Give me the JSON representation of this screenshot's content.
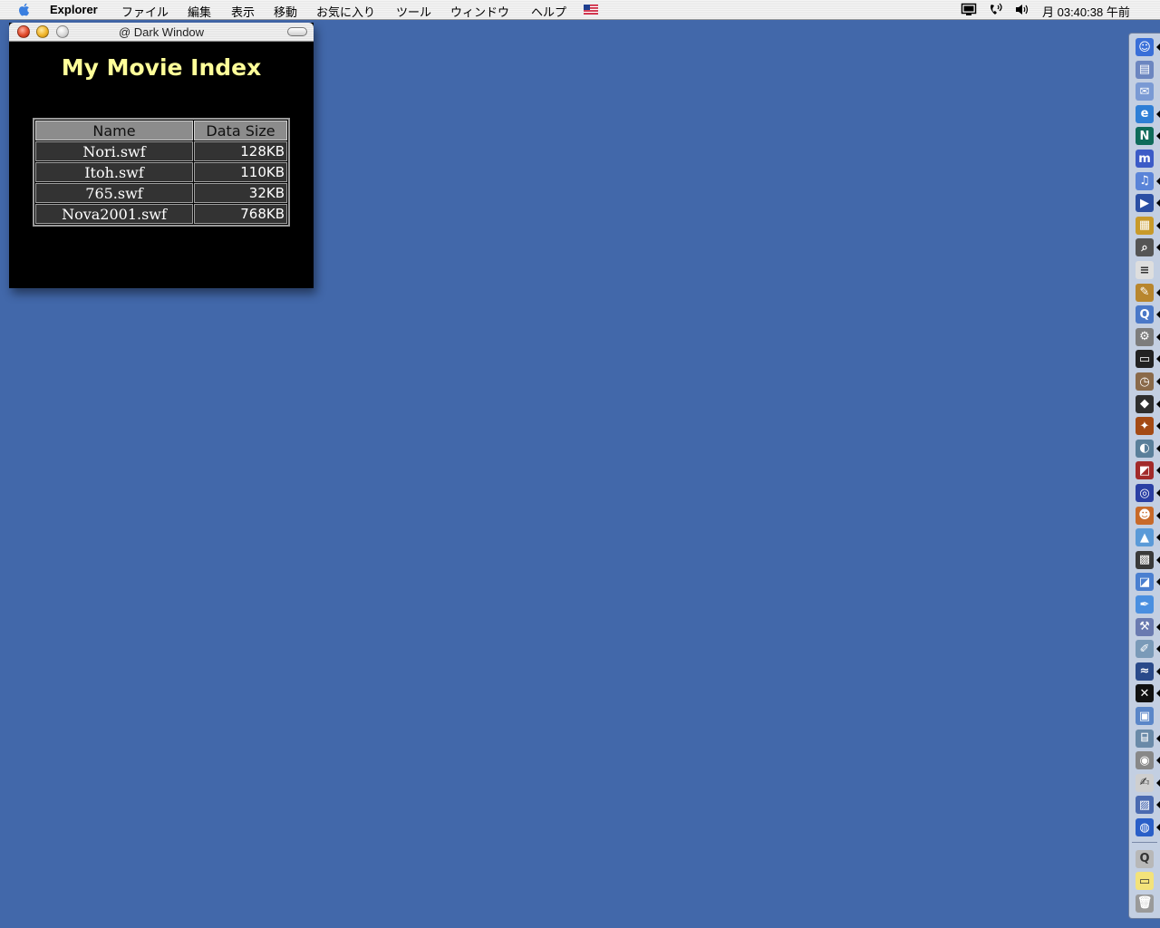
{
  "menubar": {
    "app_name": "Explorer",
    "menus": [
      "ファイル",
      "編集",
      "表示",
      "移動",
      "お気に入り",
      "ツール",
      "ウィンドウ",
      "ヘルプ"
    ],
    "clock": "月 03:40:38 午前"
  },
  "window": {
    "title": "@ Dark Window",
    "heading": "My Movie Index",
    "table": {
      "headers": [
        "Name",
        "Data Size"
      ],
      "rows": [
        {
          "name": "Nori.swf",
          "size": "128KB"
        },
        {
          "name": "Itoh.swf",
          "size": "110KB"
        },
        {
          "name": "765.swf",
          "size": "32KB"
        },
        {
          "name": "Nova2001.swf",
          "size": "768KB"
        }
      ]
    }
  },
  "colors": {
    "desktop": "#4268aa",
    "heading": "#ffff99",
    "table_header_bg": "#8c8c8c",
    "table_cell_bg": "#333333"
  },
  "dock": {
    "items": [
      {
        "icon": "finder-icon",
        "color": "#3a6fd8",
        "glyph": "☺",
        "running": true
      },
      {
        "icon": "disk-icon",
        "color": "#6c86c0",
        "glyph": "▤",
        "running": false
      },
      {
        "icon": "mail-icon",
        "color": "#7a9ad4",
        "glyph": "✉",
        "running": false
      },
      {
        "icon": "internet-explorer-icon",
        "color": "#2f7fd6",
        "glyph": "e",
        "running": true
      },
      {
        "icon": "netscape-icon",
        "color": "#0f6b5a",
        "glyph": "N",
        "running": true
      },
      {
        "icon": "app-m-icon",
        "color": "#3c5bc7",
        "glyph": "m",
        "running": false
      },
      {
        "icon": "itunes-icon",
        "color": "#5a84d8",
        "glyph": "♫",
        "running": true
      },
      {
        "icon": "clapper-icon",
        "color": "#2b4fa4",
        "glyph": "▶",
        "running": true
      },
      {
        "icon": "movie-icon",
        "color": "#c89a2a",
        "glyph": "▦",
        "running": true
      },
      {
        "icon": "sherlock-icon",
        "color": "#555555",
        "glyph": "⌕",
        "running": true
      },
      {
        "icon": "document-icon",
        "color": "#dedede",
        "glyph": "≡",
        "running": false
      },
      {
        "icon": "graphic-icon",
        "color": "#b8862e",
        "glyph": "✎",
        "running": true
      },
      {
        "icon": "quicktime-icon",
        "color": "#4a78c8",
        "glyph": "Q",
        "running": true
      },
      {
        "icon": "system-prefs-icon",
        "color": "#7d7d7d",
        "glyph": "⚙",
        "running": true
      },
      {
        "icon": "terminal-icon",
        "color": "#222222",
        "glyph": "▭",
        "running": true
      },
      {
        "icon": "clock-icon",
        "color": "#8a6a4a",
        "glyph": "◷",
        "running": true
      },
      {
        "icon": "cube-icon",
        "color": "#2e2e2e",
        "glyph": "◆",
        "running": true
      },
      {
        "icon": "dino-icon",
        "color": "#a44a14",
        "glyph": "✦",
        "running": true
      },
      {
        "icon": "flash-icon",
        "color": "#5a7f9a",
        "glyph": "◐",
        "running": true
      },
      {
        "icon": "photo-icon",
        "color": "#a22a2a",
        "glyph": "◩",
        "running": true
      },
      {
        "icon": "globe-icon",
        "color": "#2a3fa4",
        "glyph": "◎",
        "running": true
      },
      {
        "icon": "portrait-icon",
        "color": "#c86a2a",
        "glyph": "☻",
        "running": true
      },
      {
        "icon": "landscape-icon",
        "color": "#5a9ad8",
        "glyph": "▲",
        "running": true
      },
      {
        "icon": "film-icon",
        "color": "#3a3a3a",
        "glyph": "▩",
        "running": true
      },
      {
        "icon": "image-icon",
        "color": "#4a7fd0",
        "glyph": "◪",
        "running": true
      },
      {
        "icon": "pen-icon",
        "color": "#4a8fe0",
        "glyph": "✒",
        "running": false
      },
      {
        "icon": "tool-icon",
        "color": "#6a7ab0",
        "glyph": "⚒",
        "running": true
      },
      {
        "icon": "drawing-icon",
        "color": "#7a9ab8",
        "glyph": "✐",
        "running": true
      },
      {
        "icon": "wave-icon",
        "color": "#2a4a8a",
        "glyph": "≈",
        "running": true
      },
      {
        "icon": "x-icon",
        "color": "#111111",
        "glyph": "✕",
        "running": true
      },
      {
        "icon": "folder-icon",
        "color": "#5a86c8",
        "glyph": "▣",
        "running": false
      },
      {
        "icon": "scanner-icon",
        "color": "#6a8aa8",
        "glyph": "⌸",
        "running": true
      },
      {
        "icon": "camera-icon",
        "color": "#888888",
        "glyph": "◉",
        "running": true
      },
      {
        "icon": "notepad-icon",
        "color": "#cfcfcf",
        "glyph": "✍",
        "running": true
      },
      {
        "icon": "photo-tool-icon",
        "color": "#4a6ab0",
        "glyph": "▨",
        "running": true
      },
      {
        "icon": "network-icon",
        "color": "#2a5fc8",
        "glyph": "◍",
        "running": true
      },
      {
        "icon": "quicktime-player-icon",
        "color": "#b8b8b8",
        "glyph": "Q",
        "running": false
      },
      {
        "icon": "stickies-icon",
        "color": "#f3e27a",
        "glyph": "▭",
        "running": false
      },
      {
        "icon": "trash-icon",
        "color": "#9a9a9a",
        "glyph": "🗑",
        "running": false
      }
    ]
  }
}
